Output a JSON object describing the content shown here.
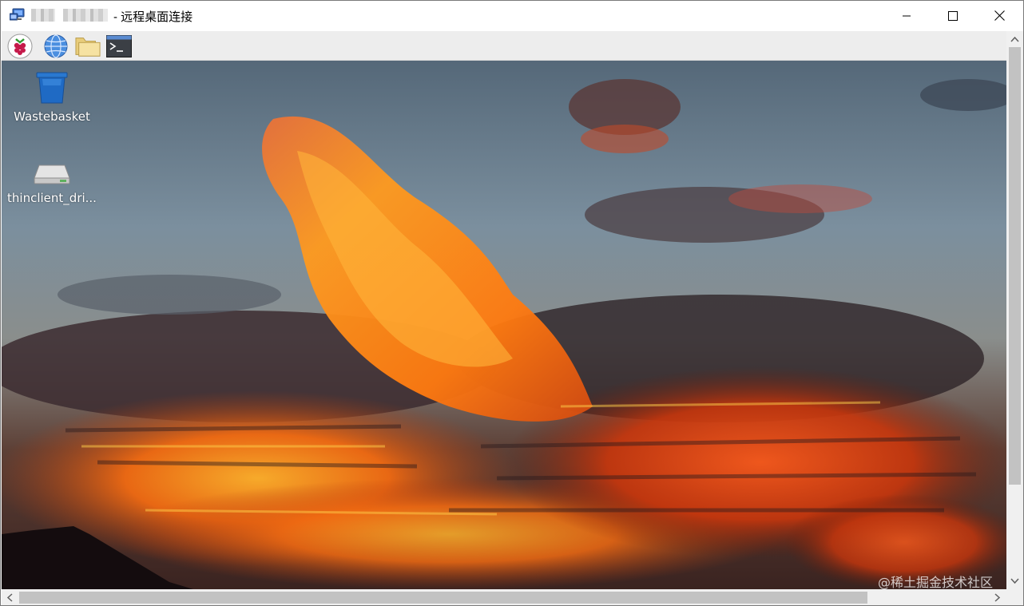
{
  "window": {
    "title": "- 远程桌面连接",
    "controls": {
      "minimize": "minimize-icon",
      "maximize": "maximize-icon",
      "close": "close-icon"
    }
  },
  "taskbar": {
    "items": [
      {
        "name": "raspberry-menu",
        "icon": "raspberry-icon"
      },
      {
        "name": "web-browser",
        "icon": "globe-icon"
      },
      {
        "name": "file-manager",
        "icon": "folder-icon"
      },
      {
        "name": "terminal",
        "icon": "terminal-icon"
      }
    ]
  },
  "desktop": {
    "icons": [
      {
        "label": "Wastebasket",
        "icon": "wastebasket-icon"
      },
      {
        "label": "thinclient_dri...",
        "icon": "drive-icon"
      }
    ],
    "wallpaper": "sunset clouds"
  },
  "watermark": "@稀土掘金技术社区",
  "colors": {
    "taskbar_bg": "#ededed",
    "scrollbar_thumb": "#c2c2c2",
    "scrollbar_track": "#f0f0f0"
  }
}
